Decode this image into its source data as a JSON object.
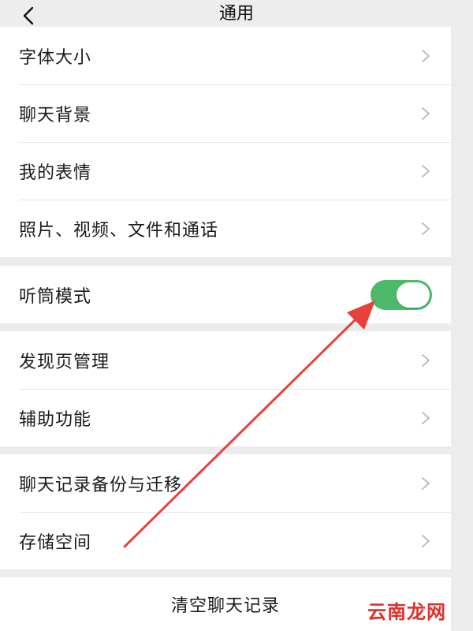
{
  "nav": {
    "title": "通用",
    "back_icon": "chevron-left-icon"
  },
  "group1": {
    "items": [
      {
        "label": "字体大小",
        "icon": "chevron-right-icon"
      },
      {
        "label": "聊天背景",
        "icon": "chevron-right-icon"
      },
      {
        "label": "我的表情",
        "icon": "chevron-right-icon"
      },
      {
        "label": "照片、视频、文件和通话",
        "icon": "chevron-right-icon"
      }
    ]
  },
  "group2": {
    "items": [
      {
        "label": "听筒模式",
        "toggle_on": true
      }
    ]
  },
  "group3": {
    "items": [
      {
        "label": "发现页管理",
        "icon": "chevron-right-icon"
      },
      {
        "label": "辅助功能",
        "icon": "chevron-right-icon"
      }
    ]
  },
  "group4": {
    "items": [
      {
        "label": "聊天记录备份与迁移",
        "icon": "chevron-right-icon"
      },
      {
        "label": "存储空间",
        "icon": "chevron-right-icon"
      }
    ]
  },
  "clear_history": {
    "label": "清空聊天记录"
  },
  "watermark": {
    "text": "云南龙网"
  },
  "colors": {
    "toggle_on": "#4cb96a",
    "arrow": "#e8413a",
    "watermark": "#e0302a",
    "background": "#ececec"
  }
}
